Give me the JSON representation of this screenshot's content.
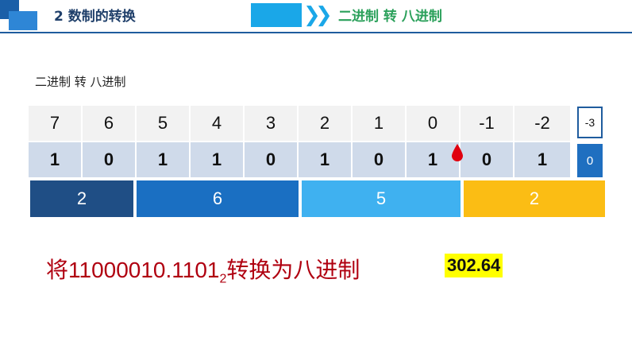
{
  "header": {
    "title": "2 数制的转换",
    "section": "二进制 转 八进制"
  },
  "subtitle": "二进制 转 八进制",
  "positions": [
    "7",
    "6",
    "5",
    "4",
    "3",
    "2",
    "1",
    "0",
    "-1",
    "-2"
  ],
  "bits": [
    "1",
    "0",
    "1",
    "1",
    "0",
    "1",
    "0",
    "1",
    "0",
    "1"
  ],
  "groups": [
    "2",
    "6",
    "5",
    "2"
  ],
  "extra": {
    "position": "-3",
    "bit": "0"
  },
  "question": {
    "prefix": "将11000010.1101",
    "subscript": "2",
    "suffix": "转换为八进制"
  },
  "answer": "302.64",
  "colors": {
    "group1": "#1f4e85",
    "group2": "#1a6fc2",
    "group3": "#3fb1f0",
    "group4": "#fbbd14",
    "accent": "#1aa7e8"
  }
}
